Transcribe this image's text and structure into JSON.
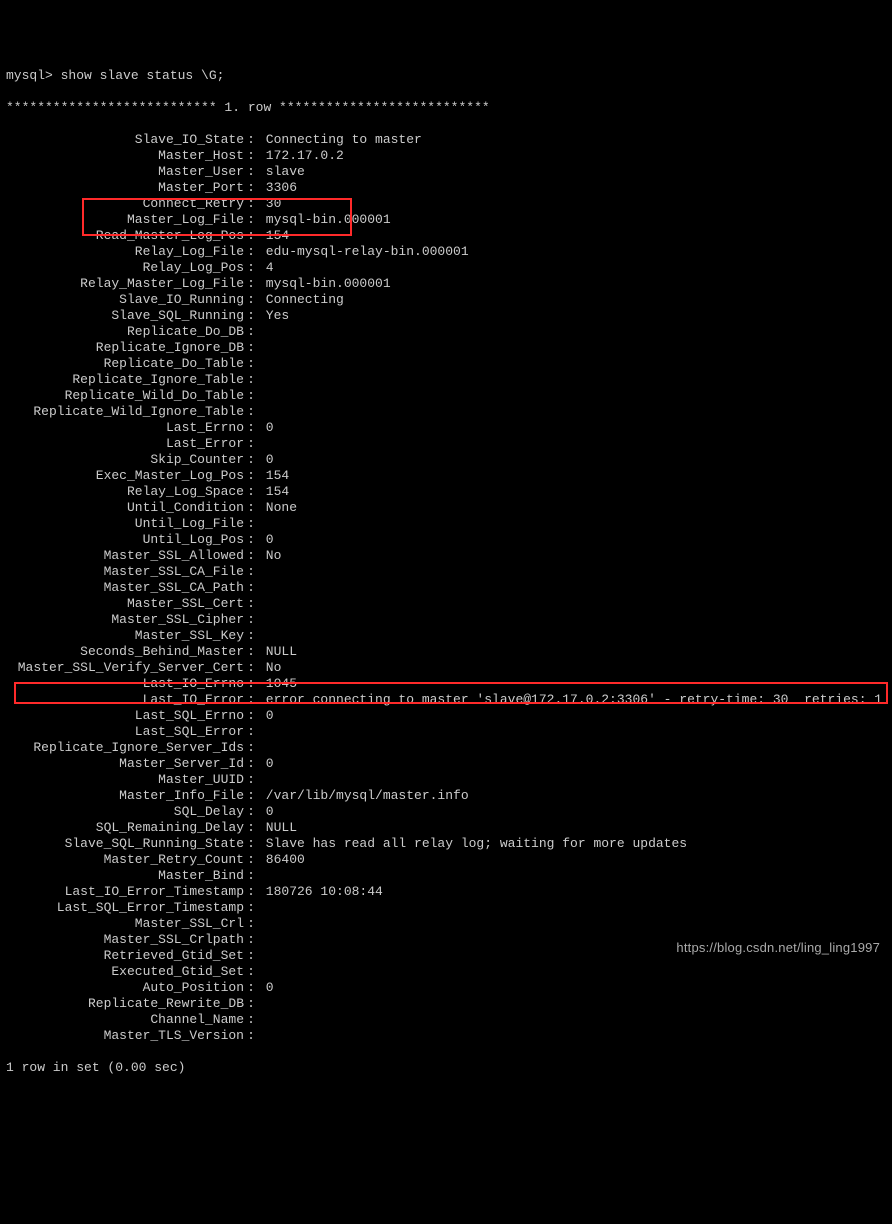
{
  "prompt": "mysql> show slave status \\G;",
  "header": "*************************** 1. row ***************************",
  "rows": [
    {
      "label": "Slave_IO_State",
      "value": "Connecting to master"
    },
    {
      "label": "Master_Host",
      "value": "172.17.0.2"
    },
    {
      "label": "Master_User",
      "value": "slave"
    },
    {
      "label": "Master_Port",
      "value": "3306"
    },
    {
      "label": "Connect_Retry",
      "value": "30"
    },
    {
      "label": "Master_Log_File",
      "value": "mysql-bin.000001"
    },
    {
      "label": "Read_Master_Log_Pos",
      "value": "154"
    },
    {
      "label": "Relay_Log_File",
      "value": "edu-mysql-relay-bin.000001"
    },
    {
      "label": "Relay_Log_Pos",
      "value": "4"
    },
    {
      "label": "Relay_Master_Log_File",
      "value": "mysql-bin.000001"
    },
    {
      "label": "Slave_IO_Running",
      "value": "Connecting"
    },
    {
      "label": "Slave_SQL_Running",
      "value": "Yes"
    },
    {
      "label": "Replicate_Do_DB",
      "value": ""
    },
    {
      "label": "Replicate_Ignore_DB",
      "value": ""
    },
    {
      "label": "Replicate_Do_Table",
      "value": ""
    },
    {
      "label": "Replicate_Ignore_Table",
      "value": ""
    },
    {
      "label": "Replicate_Wild_Do_Table",
      "value": ""
    },
    {
      "label": "Replicate_Wild_Ignore_Table",
      "value": ""
    },
    {
      "label": "Last_Errno",
      "value": "0"
    },
    {
      "label": "Last_Error",
      "value": ""
    },
    {
      "label": "Skip_Counter",
      "value": "0"
    },
    {
      "label": "Exec_Master_Log_Pos",
      "value": "154"
    },
    {
      "label": "Relay_Log_Space",
      "value": "154"
    },
    {
      "label": "Until_Condition",
      "value": "None"
    },
    {
      "label": "Until_Log_File",
      "value": ""
    },
    {
      "label": "Until_Log_Pos",
      "value": "0"
    },
    {
      "label": "Master_SSL_Allowed",
      "value": "No"
    },
    {
      "label": "Master_SSL_CA_File",
      "value": ""
    },
    {
      "label": "Master_SSL_CA_Path",
      "value": ""
    },
    {
      "label": "Master_SSL_Cert",
      "value": ""
    },
    {
      "label": "Master_SSL_Cipher",
      "value": ""
    },
    {
      "label": "Master_SSL_Key",
      "value": ""
    },
    {
      "label": "Seconds_Behind_Master",
      "value": "NULL"
    },
    {
      "label": "Master_SSL_Verify_Server_Cert",
      "value": "No"
    },
    {
      "label": "Last_IO_Errno",
      "value": "1045"
    },
    {
      "label": "Last_IO_Error",
      "value": "error connecting to master 'slave@172.17.0.2:3306' - retry-time: 30  retries: 1"
    },
    {
      "label": "Last_SQL_Errno",
      "value": "0"
    },
    {
      "label": "Last_SQL_Error",
      "value": ""
    },
    {
      "label": "Replicate_Ignore_Server_Ids",
      "value": ""
    },
    {
      "label": "Master_Server_Id",
      "value": "0"
    },
    {
      "label": "Master_UUID",
      "value": ""
    },
    {
      "label": "Master_Info_File",
      "value": "/var/lib/mysql/master.info"
    },
    {
      "label": "SQL_Delay",
      "value": "0"
    },
    {
      "label": "SQL_Remaining_Delay",
      "value": "NULL"
    },
    {
      "label": "Slave_SQL_Running_State",
      "value": "Slave has read all relay log; waiting for more updates"
    },
    {
      "label": "Master_Retry_Count",
      "value": "86400"
    },
    {
      "label": "Master_Bind",
      "value": ""
    },
    {
      "label": "Last_IO_Error_Timestamp",
      "value": "180726 10:08:44"
    },
    {
      "label": "Last_SQL_Error_Timestamp",
      "value": ""
    },
    {
      "label": "Master_SSL_Crl",
      "value": ""
    },
    {
      "label": "Master_SSL_Crlpath",
      "value": ""
    },
    {
      "label": "Retrieved_Gtid_Set",
      "value": ""
    },
    {
      "label": "Executed_Gtid_Set",
      "value": ""
    },
    {
      "label": "Auto_Position",
      "value": "0"
    },
    {
      "label": "Replicate_Rewrite_DB",
      "value": ""
    },
    {
      "label": "Channel_Name",
      "value": ""
    },
    {
      "label": "Master_TLS_Version",
      "value": ""
    }
  ],
  "footer": "1 row in set (0.00 sec)",
  "watermark": "https://blog.csdn.net/ling_ling1997",
  "highlight_rows": [
    "Slave_IO_Running",
    "Slave_SQL_Running",
    "Last_IO_Error"
  ]
}
